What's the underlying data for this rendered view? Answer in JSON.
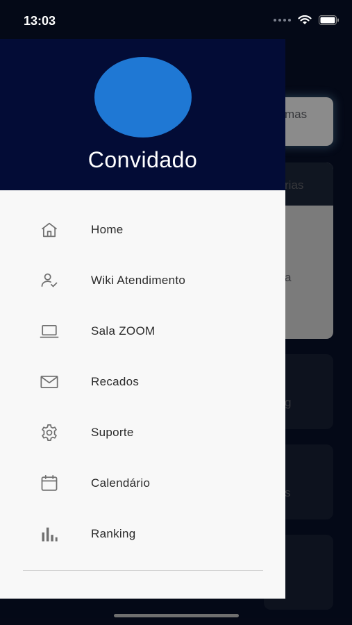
{
  "status_bar": {
    "time": "13:03"
  },
  "drawer": {
    "user_name": "Convidado",
    "menu": [
      {
        "label": "Home",
        "icon": "home-icon"
      },
      {
        "label": "Wiki Atendimento",
        "icon": "user-check-icon"
      },
      {
        "label": "Sala ZOOM",
        "icon": "laptop-icon"
      },
      {
        "label": "Recados",
        "icon": "mail-icon"
      },
      {
        "label": "Suporte",
        "icon": "gear-icon"
      },
      {
        "label": "Calendário",
        "icon": "calendar-icon"
      },
      {
        "label": "Ranking",
        "icon": "bar-chart-icon"
      }
    ]
  },
  "background": {
    "fragments": [
      "mas",
      "rias",
      "a",
      "g",
      "s"
    ]
  },
  "colors": {
    "drawer_header": "#030c36",
    "avatar": "#1f78d4",
    "drawer_body": "#f8f8f8",
    "app_background": "#060c1f"
  }
}
